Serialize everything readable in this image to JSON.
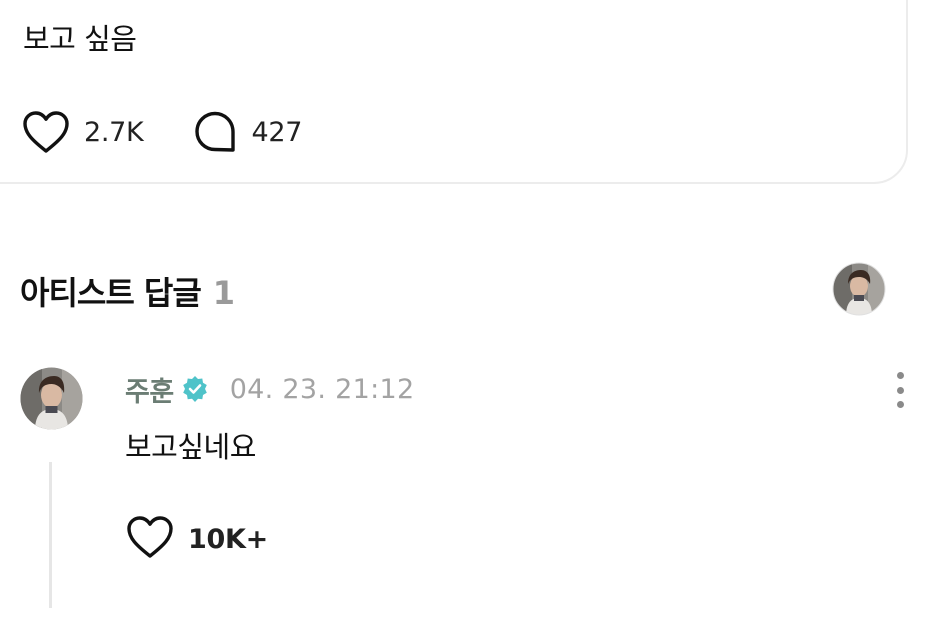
{
  "post": {
    "text": "보고 싶음",
    "likes": "2.7K",
    "comments": "427"
  },
  "artist_replies": {
    "title": "아티스트 답글",
    "count": "1"
  },
  "comment": {
    "author": "주훈",
    "timestamp": "04. 23. 21:12",
    "text": "보고싶네요",
    "likes": "10K+"
  },
  "icons": {
    "like": "heart-outline-icon",
    "comment": "speech-bubble-icon",
    "verified": "verified-badge-icon",
    "more": "more-vertical-icon"
  },
  "colors": {
    "verified": "#4fc3c9",
    "author": "#6b7d74",
    "muted": "#a3a3a3"
  }
}
